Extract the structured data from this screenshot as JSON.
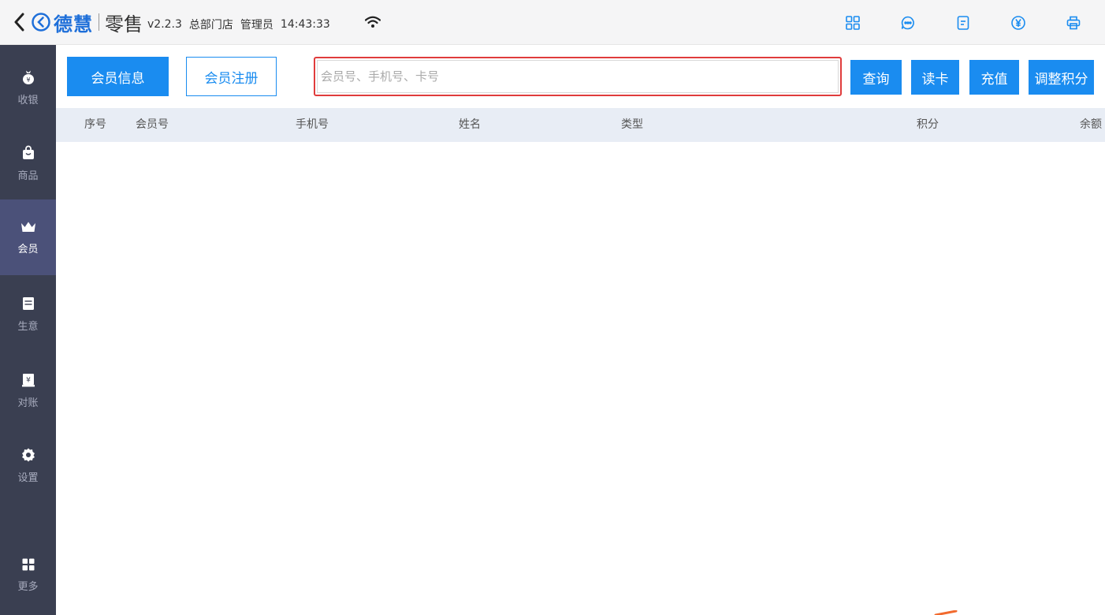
{
  "header": {
    "brand": "德慧",
    "product": "零售",
    "version": "v2.2.3",
    "store": "总部门店",
    "role": "管理员",
    "time": "14:43:33",
    "icons": [
      "back-icon",
      "logo-icon",
      "wifi-icon",
      "grid-icon",
      "chat-icon",
      "document-icon",
      "yen-icon",
      "printer-icon"
    ]
  },
  "sidebar": {
    "items": [
      {
        "label": "收银",
        "icon": "money-bag-icon"
      },
      {
        "label": "商品",
        "icon": "shopping-bag-icon"
      },
      {
        "label": "会员",
        "icon": "crown-icon",
        "active": true
      },
      {
        "label": "生意",
        "icon": "ledger-icon"
      },
      {
        "label": "对账",
        "icon": "reconcile-icon"
      },
      {
        "label": "设置",
        "icon": "gear-icon"
      },
      {
        "label": "更多",
        "icon": "apps-icon"
      }
    ]
  },
  "toolbar": {
    "member_info_label": "会员信息",
    "member_register_label": "会员注册",
    "search_placeholder": "会员号、手机号、卡号",
    "search_value": "",
    "query_label": "查询",
    "read_card_label": "读卡",
    "recharge_label": "充值",
    "adjust_points_label": "调整积分"
  },
  "table": {
    "columns": [
      "序号",
      "会员号",
      "手机号",
      "姓名",
      "类型",
      "积分",
      "余额"
    ],
    "rows": []
  },
  "colors": {
    "accent": "#1a8cf0",
    "sidebar_bg": "#3a3f51",
    "sidebar_active": "#4b5179",
    "search_highlight": "#e03c3c",
    "table_header_bg": "#e8edf5"
  }
}
